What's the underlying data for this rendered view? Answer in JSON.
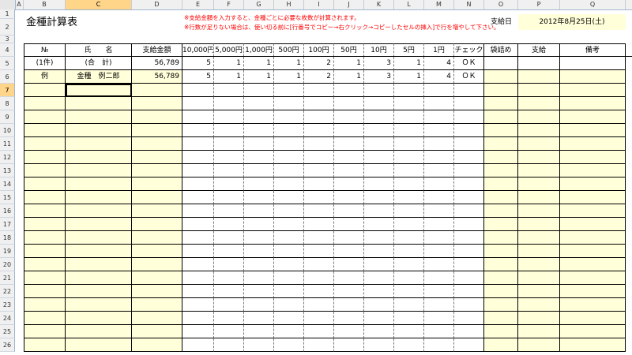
{
  "columns": [
    "A",
    "B",
    "C",
    "D",
    "E",
    "F",
    "G",
    "H",
    "I",
    "J",
    "K",
    "L",
    "M",
    "N",
    "O",
    "P",
    "Q"
  ],
  "rows": [
    "1",
    "2",
    "3",
    "4",
    "5",
    "6",
    "7",
    "8",
    "9",
    "10",
    "11",
    "12",
    "13",
    "14",
    "15",
    "16",
    "17",
    "18",
    "19",
    "20",
    "21",
    "22",
    "23",
    "24",
    "25",
    "26"
  ],
  "title": "金種計算表",
  "note1": "※支給金額を入力すると、金種ごとに必要な枚数が計算されます。",
  "note2": "※行数が足りない場合は、使い切る前に[行番号でコピー→右クリック→コピーしたセルの挿入]で行を増やして下さい。",
  "pay_date_label": "支給日",
  "pay_date_value": "2012年8月25日(土)",
  "headers": [
    "№",
    "氏　　名",
    "支給金額",
    "10,000円",
    "5,000円",
    "1,000円",
    "500円",
    "100円",
    "50円",
    "10円",
    "5円",
    "1円",
    "チェック",
    "袋詰め",
    "支給",
    "備考"
  ],
  "total_row": [
    "(1件)",
    "(合　計)",
    "56,789",
    "5",
    "1",
    "1",
    "1",
    "2",
    "1",
    "3",
    "1",
    "4",
    "ＯＫ",
    "",
    "",
    ""
  ],
  "example_row": [
    "例",
    "金種　例二郎",
    "56,789",
    "5",
    "1",
    "1",
    "1",
    "2",
    "1",
    "3",
    "1",
    "4",
    "ＯＫ",
    "",
    "",
    ""
  ],
  "colors": {
    "yellow": "#ffffd9",
    "red_note": "#ff0000",
    "selection": "#ffd58a"
  }
}
